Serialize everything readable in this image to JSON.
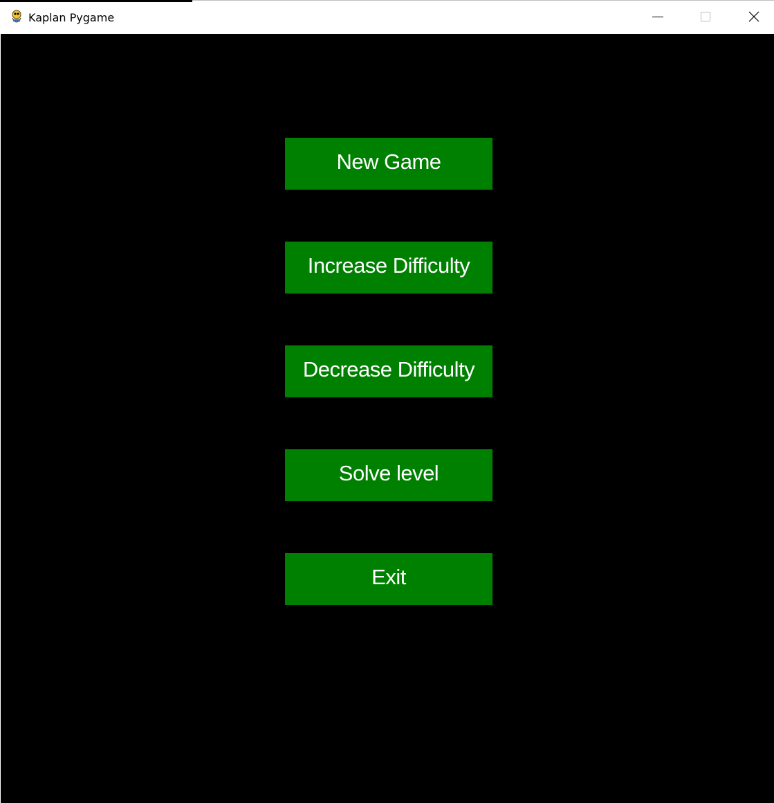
{
  "window": {
    "title": "Kaplan Pygame",
    "app_icon": "pygame-snake-icon",
    "controls": [
      "minimize-icon",
      "maximize-icon",
      "close-icon"
    ]
  },
  "colors": {
    "background": "#000000",
    "button": "#008000",
    "button_text": "#ffffff",
    "titlebar": "#ffffff"
  },
  "menu": {
    "buttons": [
      {
        "label": "New Game"
      },
      {
        "label": "Increase Difficulty"
      },
      {
        "label": "Decrease Difficulty"
      },
      {
        "label": "Solve level"
      },
      {
        "label": "Exit"
      }
    ]
  }
}
